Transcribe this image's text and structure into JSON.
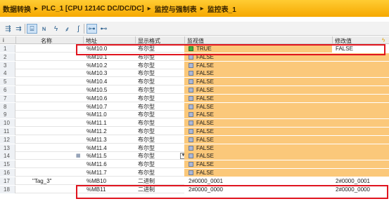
{
  "breadcrumb": [
    "数据转换",
    "PLC_1 [CPU 1214C DC/DC/DC]",
    "监控与强制表",
    "监控表_1"
  ],
  "breadcrumb_separator": "▸",
  "toolbar": {
    "buttons": [
      {
        "name": "insert-row-icon",
        "glyph": "⇶"
      },
      {
        "name": "add-row-icon",
        "glyph": "⇉"
      },
      {
        "name": "display-format-icon",
        "glyph": "⌸"
      },
      {
        "name": "lock-format-icon",
        "glyph": "ɴ"
      },
      {
        "name": "modify-now-icon",
        "glyph": "ϟ"
      },
      {
        "name": "modify-trigger-icon",
        "glyph": "⸙"
      },
      {
        "name": "modify-lock-icon",
        "glyph": "ʃ"
      },
      {
        "name": "monitor-all-icon",
        "glyph": "⊶"
      },
      {
        "name": "monitor-once-icon",
        "glyph": "⊷"
      }
    ]
  },
  "table": {
    "headers": {
      "index": "i",
      "name": "名称",
      "address": "地址",
      "format": "显示格式",
      "monitor": "监视值",
      "modify": "修改值",
      "force": "ϟ"
    },
    "rows": [
      {
        "index": "1",
        "name": "",
        "address": "%M10.0",
        "format": "布尔型",
        "monitor": "TRUE",
        "monitor_state": "on",
        "modify": "FALSE"
      },
      {
        "index": "2",
        "name": "",
        "address": "%M10.1",
        "format": "布尔型",
        "monitor": "FALSE",
        "monitor_state": "off",
        "modify": ""
      },
      {
        "index": "3",
        "name": "",
        "address": "%M10.2",
        "format": "布尔型",
        "monitor": "FALSE",
        "monitor_state": "off",
        "modify": ""
      },
      {
        "index": "4",
        "name": "",
        "address": "%M10.3",
        "format": "布尔型",
        "monitor": "FALSE",
        "monitor_state": "off",
        "modify": ""
      },
      {
        "index": "5",
        "name": "",
        "address": "%M10.4",
        "format": "布尔型",
        "monitor": "FALSE",
        "monitor_state": "off",
        "modify": ""
      },
      {
        "index": "6",
        "name": "",
        "address": "%M10.5",
        "format": "布尔型",
        "monitor": "FALSE",
        "monitor_state": "off",
        "modify": ""
      },
      {
        "index": "7",
        "name": "",
        "address": "%M10.6",
        "format": "布尔型",
        "monitor": "FALSE",
        "monitor_state": "off",
        "modify": ""
      },
      {
        "index": "8",
        "name": "",
        "address": "%M10.7",
        "format": "布尔型",
        "monitor": "FALSE",
        "monitor_state": "off",
        "modify": ""
      },
      {
        "index": "9",
        "name": "",
        "address": "%M11.0",
        "format": "布尔型",
        "monitor": "FALSE",
        "monitor_state": "off",
        "modify": ""
      },
      {
        "index": "10",
        "name": "",
        "address": "%M11.1",
        "format": "布尔型",
        "monitor": "FALSE",
        "monitor_state": "off",
        "modify": ""
      },
      {
        "index": "11",
        "name": "",
        "address": "%M11.2",
        "format": "布尔型",
        "monitor": "FALSE",
        "monitor_state": "off",
        "modify": ""
      },
      {
        "index": "12",
        "name": "",
        "address": "%M11.3",
        "format": "布尔型",
        "monitor": "FALSE",
        "monitor_state": "off",
        "modify": ""
      },
      {
        "index": "13",
        "name": "",
        "address": "%M11.4",
        "format": "布尔型",
        "monitor": "FALSE",
        "monitor_state": "off",
        "modify": ""
      },
      {
        "index": "14",
        "name": "",
        "address": "%M11.5",
        "format": "布尔型",
        "monitor": "FALSE",
        "monitor_state": "off",
        "modify": "",
        "editing": true
      },
      {
        "index": "15",
        "name": "",
        "address": "%M11.6",
        "format": "布尔型",
        "monitor": "FALSE",
        "monitor_state": "off",
        "modify": ""
      },
      {
        "index": "16",
        "name": "",
        "address": "%M11.7",
        "format": "布尔型",
        "monitor": "FALSE",
        "monitor_state": "off",
        "modify": ""
      },
      {
        "index": "17",
        "name": "\"Tag_3\"",
        "address": "%MB10",
        "format": "二进制",
        "monitor": "2#0000_0001",
        "monitor_state": "none",
        "modify": "2#0000_0001"
      },
      {
        "index": "18",
        "name": "",
        "address": "%MB11",
        "format": "二进制",
        "monitor": "2#0000_0000",
        "monitor_state": "none",
        "modify": "2#0000_0000"
      }
    ]
  },
  "colors": {
    "title_bar": "#f6a800",
    "monitor_bg": "#fbc87a",
    "highlight": "#e0141e",
    "true_indicator": "#3fae3f"
  }
}
